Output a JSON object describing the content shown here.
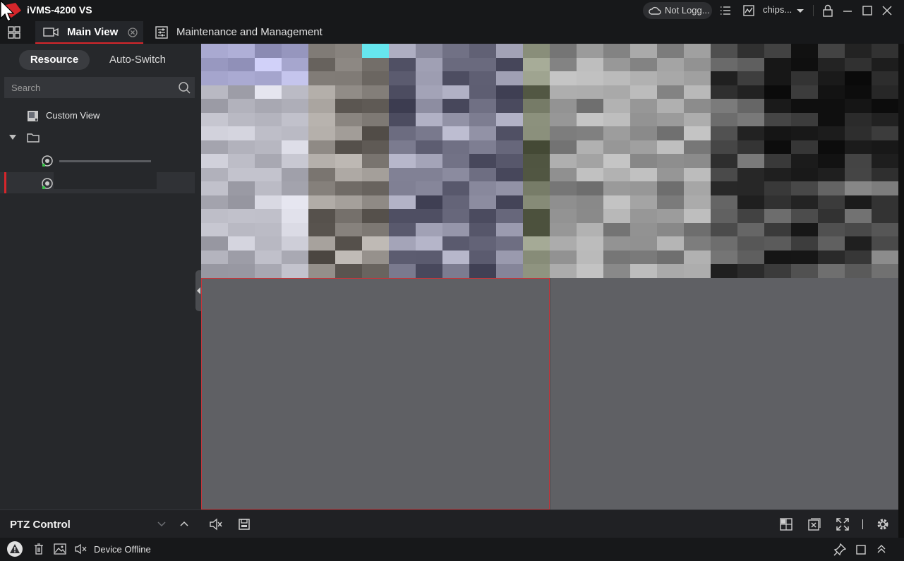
{
  "app": {
    "title": "iVMS-4200 VS"
  },
  "header": {
    "login_status": "Not Logg...",
    "user_name": "chips..."
  },
  "tabs": [
    {
      "label": "Main View"
    },
    {
      "label": "Maintenance and Management"
    }
  ],
  "sidebar": {
    "segments": [
      "Resource",
      "Auto-Switch"
    ],
    "search_placeholder": "Search",
    "tree": [
      {
        "label": "Custom View"
      },
      {
        "label": ""
      }
    ]
  },
  "ptz": {
    "label": "PTZ Control"
  },
  "status": {
    "message": "Device Offline"
  },
  "colors": {
    "accent": "#d6262b",
    "panel": "#26282b",
    "video_empty": "#5f6064"
  }
}
